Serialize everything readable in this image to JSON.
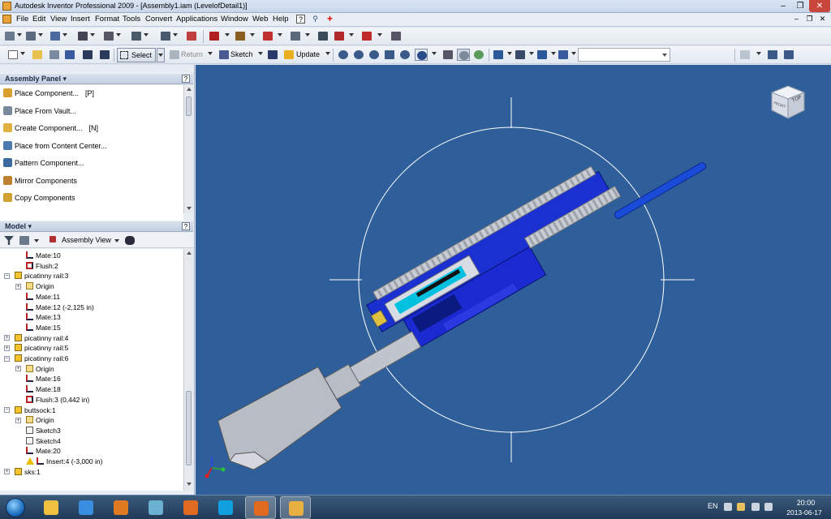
{
  "window": {
    "title": "Autodesk Inventor Professional 2009 - [Assembly1.iam (LevelofDetail1)]",
    "min_glyph": "–",
    "max_glyph": "❐",
    "close_glyph": "✕"
  },
  "menubar": {
    "items": [
      "File",
      "Edit",
      "View",
      "Insert",
      "Format",
      "Tools",
      "Convert",
      "Applications",
      "Window",
      "Web",
      "Help"
    ],
    "doc_controls": [
      "–",
      "❐",
      "✕"
    ]
  },
  "toolbar2": {
    "select_label": "Select",
    "return_label": "Return",
    "sketch_label": "Sketch",
    "update_label": "Update",
    "combo_value": ""
  },
  "assembly_panel": {
    "title": "Assembly Panel ▾",
    "help": "?",
    "commands": [
      {
        "label": "Place Component...",
        "shortcut": "[P]",
        "icon": "place-component-icon",
        "color": "#d9a030"
      },
      {
        "label": "Place From Vault...",
        "shortcut": "",
        "icon": "vault-icon",
        "color": "#7a8a9a"
      },
      {
        "label": "Create Component...",
        "shortcut": "[N]",
        "icon": "create-component-icon",
        "color": "#e0b040"
      },
      {
        "label": "Place from Content Center...",
        "shortcut": "",
        "icon": "content-center-icon",
        "color": "#4a7ab0"
      },
      {
        "label": "Pattern Component...",
        "shortcut": "",
        "icon": "pattern-icon",
        "color": "#3a6aa0"
      },
      {
        "label": "Mirror Components",
        "shortcut": "",
        "icon": "mirror-icon",
        "color": "#c08030"
      },
      {
        "label": "Copy Components",
        "shortcut": "",
        "icon": "copy-icon",
        "color": "#d0a030"
      }
    ]
  },
  "model_panel": {
    "title": "Model ▾",
    "help": "?",
    "view_label": "Assembly View",
    "tree": [
      {
        "label": "Mate:10",
        "type": "mate",
        "level": 2
      },
      {
        "label": "Flush:2",
        "type": "flush",
        "level": 2
      },
      {
        "label": "picatinny rail:3",
        "type": "part",
        "level": 1,
        "expander": "−"
      },
      {
        "label": "Origin",
        "type": "origin",
        "level": 2,
        "expander": "+"
      },
      {
        "label": "Mate:11",
        "type": "mate",
        "level": 2
      },
      {
        "label": "Mate:12 (-2,125 in)",
        "type": "mate",
        "level": 2
      },
      {
        "label": "Mate:13",
        "type": "mate",
        "level": 2
      },
      {
        "label": "Mate:15",
        "type": "mate",
        "level": 2
      },
      {
        "label": "picatinny rail:4",
        "type": "part",
        "level": 1,
        "expander": "+"
      },
      {
        "label": "picatinny rail:5",
        "type": "part",
        "level": 1,
        "expander": "+"
      },
      {
        "label": "picatinny rail:6",
        "type": "part",
        "level": 1,
        "expander": "−"
      },
      {
        "label": "Origin",
        "type": "origin",
        "level": 2,
        "expander": "+"
      },
      {
        "label": "Mate:16",
        "type": "mate",
        "level": 2
      },
      {
        "label": "Mate:18",
        "type": "mate",
        "level": 2
      },
      {
        "label": "Flush:3 (0,442 in)",
        "type": "flush",
        "level": 2
      },
      {
        "label": "buttsock:1",
        "type": "part",
        "level": 1,
        "expander": "−"
      },
      {
        "label": "Origin",
        "type": "origin",
        "level": 2,
        "expander": "+"
      },
      {
        "label": "Sketch3",
        "type": "sketch",
        "level": 2
      },
      {
        "label": "Sketch4",
        "type": "sketch",
        "level": 2
      },
      {
        "label": "Mate:20",
        "type": "mate",
        "level": 2
      },
      {
        "label": "Insert:4 (-3,000 in)",
        "type": "insert-warning",
        "level": 2
      },
      {
        "label": "sks:1",
        "type": "part",
        "level": 1,
        "expander": "+"
      }
    ]
  },
  "viewcube": {
    "face_labels": [
      "TOP",
      "FRONT"
    ]
  },
  "taskbar": {
    "apps": [
      {
        "name": "explorer",
        "color": "#f0c040",
        "active": false
      },
      {
        "name": "internet-explorer",
        "color": "#3a8ee0",
        "active": false
      },
      {
        "name": "media-player",
        "color": "#e07a20",
        "active": false
      },
      {
        "name": "notes",
        "color": "#6ab0d0",
        "active": false
      },
      {
        "name": "firefox",
        "color": "#e06a20",
        "active": false
      },
      {
        "name": "skype",
        "color": "#10a0e0",
        "active": false
      },
      {
        "name": "firefox",
        "color": "#e06a20",
        "active": true
      },
      {
        "name": "inventor",
        "color": "#e8b040",
        "active": true
      }
    ],
    "language": "EN",
    "time": "20:00",
    "date": "2013-06-17"
  }
}
